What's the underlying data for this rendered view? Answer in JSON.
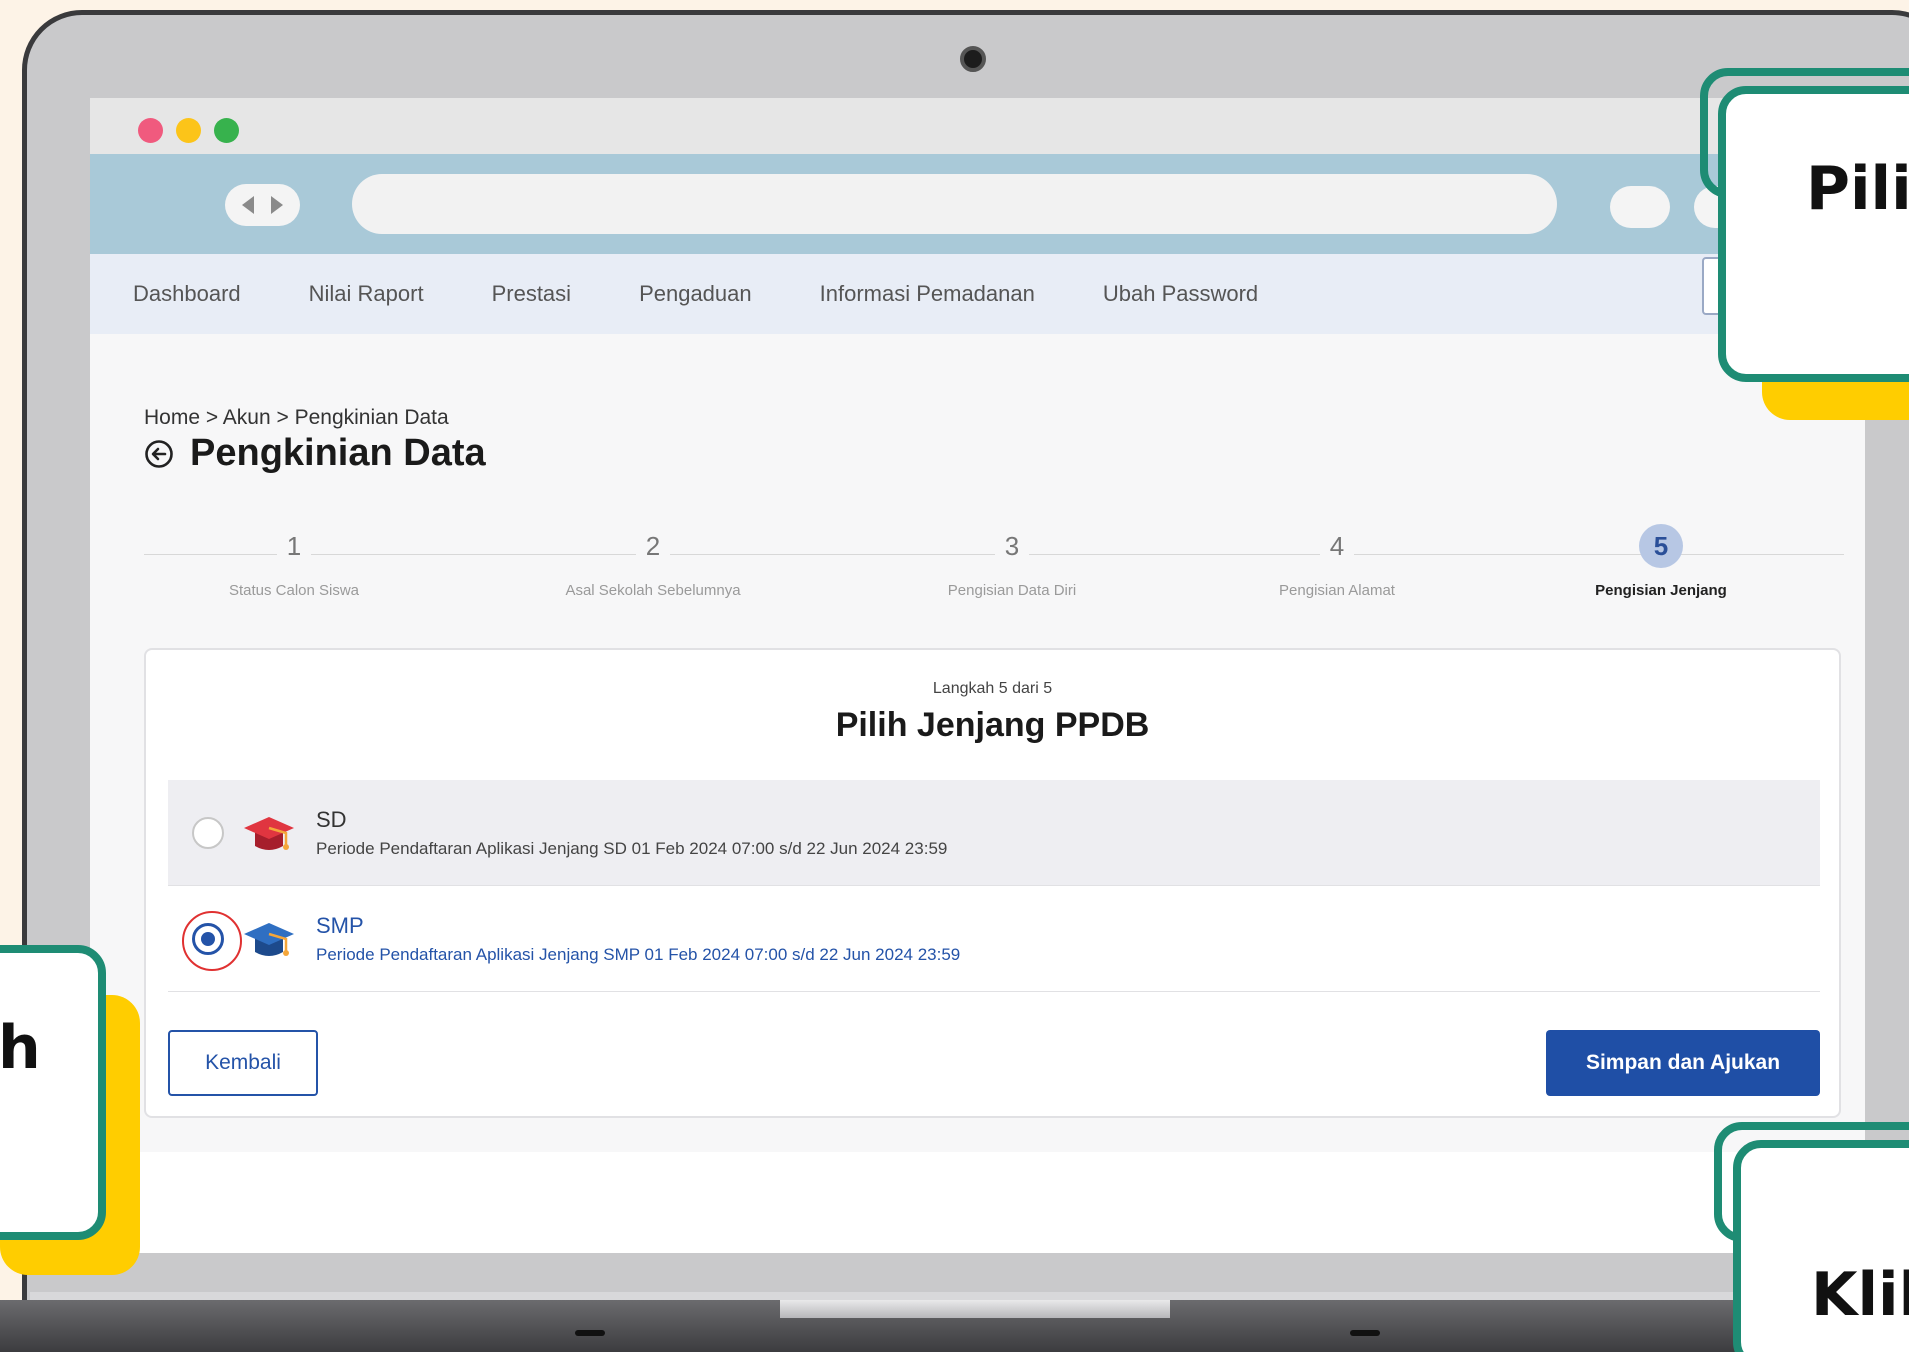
{
  "menu": {
    "items": [
      "Dashboard",
      "Nilai Raport",
      "Prestasi",
      "Pengaduan",
      "Informasi Pemadanan",
      "Ubah Password"
    ]
  },
  "breadcrumb": "Home > Akun > Pengkinian Data",
  "page_title": "Pengkinian Data",
  "steps": [
    {
      "num": "1",
      "label": "Status Calon Siswa"
    },
    {
      "num": "2",
      "label": "Asal Sekolah Sebelumnya"
    },
    {
      "num": "3",
      "label": "Pengisian Data Diri"
    },
    {
      "num": "4",
      "label": "Pengisian Alamat"
    },
    {
      "num": "5",
      "label": "Pengisian Jenjang"
    }
  ],
  "active_step": 5,
  "card": {
    "subtitle": "Langkah 5 dari 5",
    "title": "Pilih Jenjang PPDB",
    "options": [
      {
        "name": "SD",
        "desc": "Periode Pendaftaran Aplikasi Jenjang SD 01 Feb 2024 07:00 s/d 22 Jun 2024 23:59",
        "selected": false
      },
      {
        "name": "SMP",
        "desc": "Periode Pendaftaran Aplikasi Jenjang SMP 01 Feb 2024 07:00 s/d 22 Jun 2024 23:59",
        "selected": true
      }
    ],
    "back_label": "Kembali",
    "submit_label": "Simpan dan Ajukan"
  },
  "callouts": {
    "top_right": "Pili",
    "left": "h",
    "bottom_right": "Klil"
  },
  "colors": {
    "accent": "#1f4fa6",
    "callout_border": "#1e8c74",
    "callout_shadow": "#ffcd00"
  }
}
